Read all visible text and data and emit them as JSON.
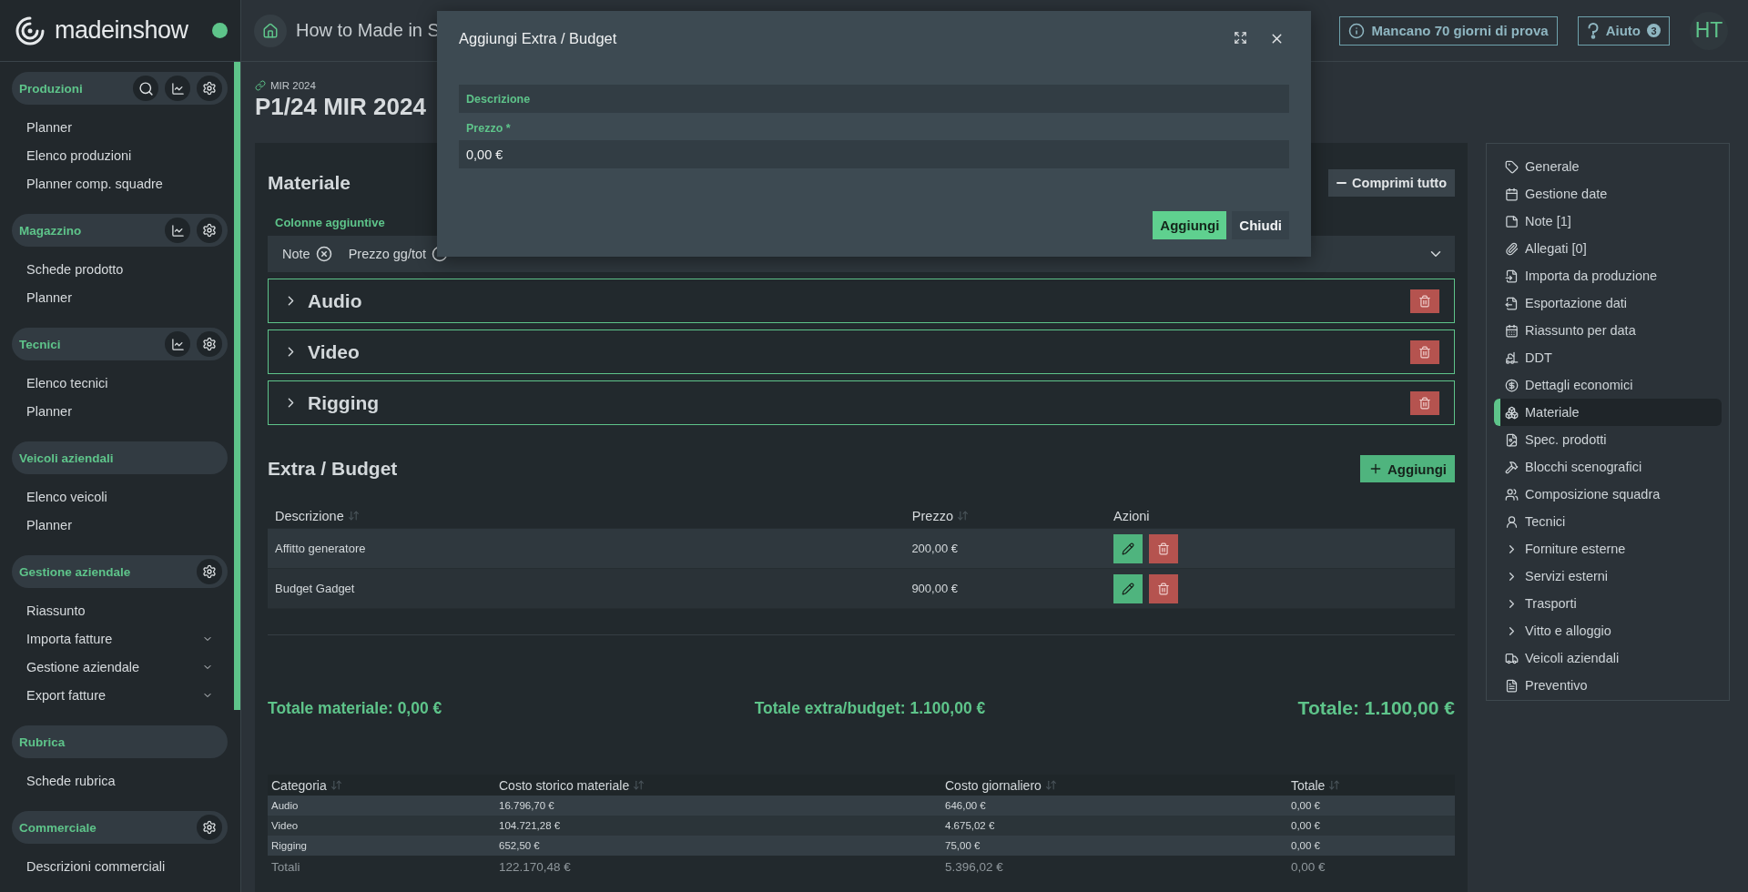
{
  "app": {
    "logo": "madeinshow",
    "title": "How to Made in S"
  },
  "header_actions": {
    "trial": "Mancano 70 giorni di prova",
    "help": "Aiuto",
    "help_badge": "3",
    "avatar": "HT"
  },
  "sidebar": [
    {
      "title": "Produzioni",
      "tools": [
        {
          "kind": "search"
        },
        {
          "kind": "chart"
        },
        {
          "kind": "settings"
        }
      ],
      "items": [
        {
          "label": "Planner",
          "expandable": false
        },
        {
          "label": "Elenco produzioni",
          "expandable": false
        },
        {
          "label": "Planner comp. squadre",
          "expandable": false
        }
      ]
    },
    {
      "title": "Magazzino",
      "tools": [
        {
          "kind": "chart"
        },
        {
          "kind": "settings"
        }
      ],
      "items": [
        {
          "label": "Schede prodotto",
          "expandable": false
        },
        {
          "label": "Planner",
          "expandable": false
        }
      ]
    },
    {
      "title": "Tecnici",
      "tools": [
        {
          "kind": "chart"
        },
        {
          "kind": "settings"
        }
      ],
      "items": [
        {
          "label": "Elenco tecnici",
          "expandable": false
        },
        {
          "label": "Planner",
          "expandable": false
        }
      ]
    },
    {
      "title": "Veicoli aziendali",
      "items": [
        {
          "label": "Elenco veicoli",
          "expandable": false
        },
        {
          "label": "Planner",
          "expandable": false
        }
      ]
    },
    {
      "title": "Gestione aziendale",
      "tools": [
        {
          "kind": "settings"
        }
      ],
      "items": [
        {
          "label": "Riassunto",
          "expandable": false
        },
        {
          "label": "Importa fatture",
          "expandable": true
        },
        {
          "label": "Gestione aziendale",
          "expandable": true
        },
        {
          "label": "Export fatture",
          "expandable": true
        }
      ]
    },
    {
      "title": "Rubrica",
      "items": [
        {
          "label": "Schede rubrica",
          "expandable": false
        }
      ]
    },
    {
      "title": "Commerciale",
      "tools": [
        {
          "kind": "settings"
        }
      ],
      "items": [
        {
          "label": "Descrizioni commerciali",
          "expandable": false
        }
      ]
    }
  ],
  "page": {
    "breadcrumb": "MIR 2024",
    "title": "P1/24 MIR 2024"
  },
  "materiale": {
    "title": "Materiale",
    "action": "Comprimi tutto",
    "columns_label": "Colonne aggiuntive",
    "columns": [
      "Note",
      "Prezzo gg/tot"
    ],
    "groups": [
      {
        "label": "Audio",
        "expanded": false
      },
      {
        "label": "Video",
        "expanded": false
      },
      {
        "label": "Rigging",
        "expanded": false
      }
    ]
  },
  "extra": {
    "title": "Extra / Budget",
    "add": "Aggiungi",
    "columns": [
      {
        "label": "Descrizione",
        "sortable": true
      },
      {
        "label": "Prezzo",
        "sortable": true
      },
      {
        "label": "Azioni",
        "sortable": false
      }
    ],
    "rows": [
      {
        "description": "Affitto generatore",
        "price": "200,00 €"
      },
      {
        "description": "Budget Gadget",
        "price": "900,00 €"
      }
    ]
  },
  "totals": {
    "material": "Totale materiale: 0,00 €",
    "extra": "Totale extra/budget: 1.100,00 €",
    "total": "Totale: 1.100,00 €"
  },
  "summary": {
    "columns": [
      {
        "label": "Categoria",
        "sortable": true
      },
      {
        "label": "Costo storico materiale",
        "sortable": true
      },
      {
        "label": "Costo giornaliero",
        "sortable": true
      },
      {
        "label": "Totale",
        "sortable": true
      }
    ],
    "rows": [
      [
        "Audio",
        "16.796,70 €",
        "646,00 €",
        "0,00 €"
      ],
      [
        "Video",
        "104.721,28 €",
        "4.675,02 €",
        "0,00 €"
      ],
      [
        "Rigging",
        "652,50 €",
        "75,00 €",
        "0,00 €"
      ]
    ],
    "footer": [
      "Totali",
      "122.170,48 €",
      "5.396,02 €",
      "0,00 €"
    ]
  },
  "right_nav": [
    {
      "label": "Generale",
      "kind": "tag",
      "selected": false
    },
    {
      "label": "Gestione date",
      "kind": "calendar",
      "selected": false
    },
    {
      "label": "Note [1]",
      "kind": "note",
      "selected": false
    },
    {
      "label": "Allegati [0]",
      "kind": "paperclip",
      "selected": false
    },
    {
      "label": "Importa da produzione",
      "kind": "import",
      "selected": false
    },
    {
      "label": "Esportazione dati",
      "kind": "export",
      "selected": false
    },
    {
      "label": "Riassunto per data",
      "kind": "summary",
      "selected": false
    },
    {
      "label": "DDT",
      "kind": "delivery",
      "selected": false
    },
    {
      "label": "Dettagli economici",
      "kind": "economics",
      "selected": false
    },
    {
      "label": "Materiale",
      "kind": "material",
      "selected": true
    },
    {
      "label": "Spec. prodotti",
      "kind": "specs",
      "selected": false
    },
    {
      "label": "Blocchi scenografici",
      "kind": "scenery",
      "selected": false
    },
    {
      "label": "Composizione squadra",
      "kind": "team",
      "selected": false
    },
    {
      "label": "Tecnici",
      "kind": "technician",
      "selected": false
    },
    {
      "label": "Forniture esterne",
      "kind": "group",
      "selected": false
    },
    {
      "label": "Servizi esterni",
      "kind": "group",
      "selected": false
    },
    {
      "label": "Trasporti",
      "kind": "group",
      "selected": false
    },
    {
      "label": "Vitto e alloggio",
      "kind": "group",
      "selected": false
    },
    {
      "label": "Veicoli aziendali",
      "kind": "vehicles",
      "selected": false
    },
    {
      "label": "Preventivo",
      "kind": "quote",
      "selected": false
    }
  ],
  "modal": {
    "title": "Aggiungi Extra / Budget",
    "fields": [
      {
        "kind": "floating",
        "label": "Descrizione"
      },
      {
        "kind": "stacked",
        "label": "Prezzo *",
        "value": "0,00 €"
      }
    ],
    "buttons": [
      {
        "label": "Aggiungi",
        "kind": "primary"
      },
      {
        "label": "Chiudi",
        "kind": "secondary"
      }
    ]
  }
}
